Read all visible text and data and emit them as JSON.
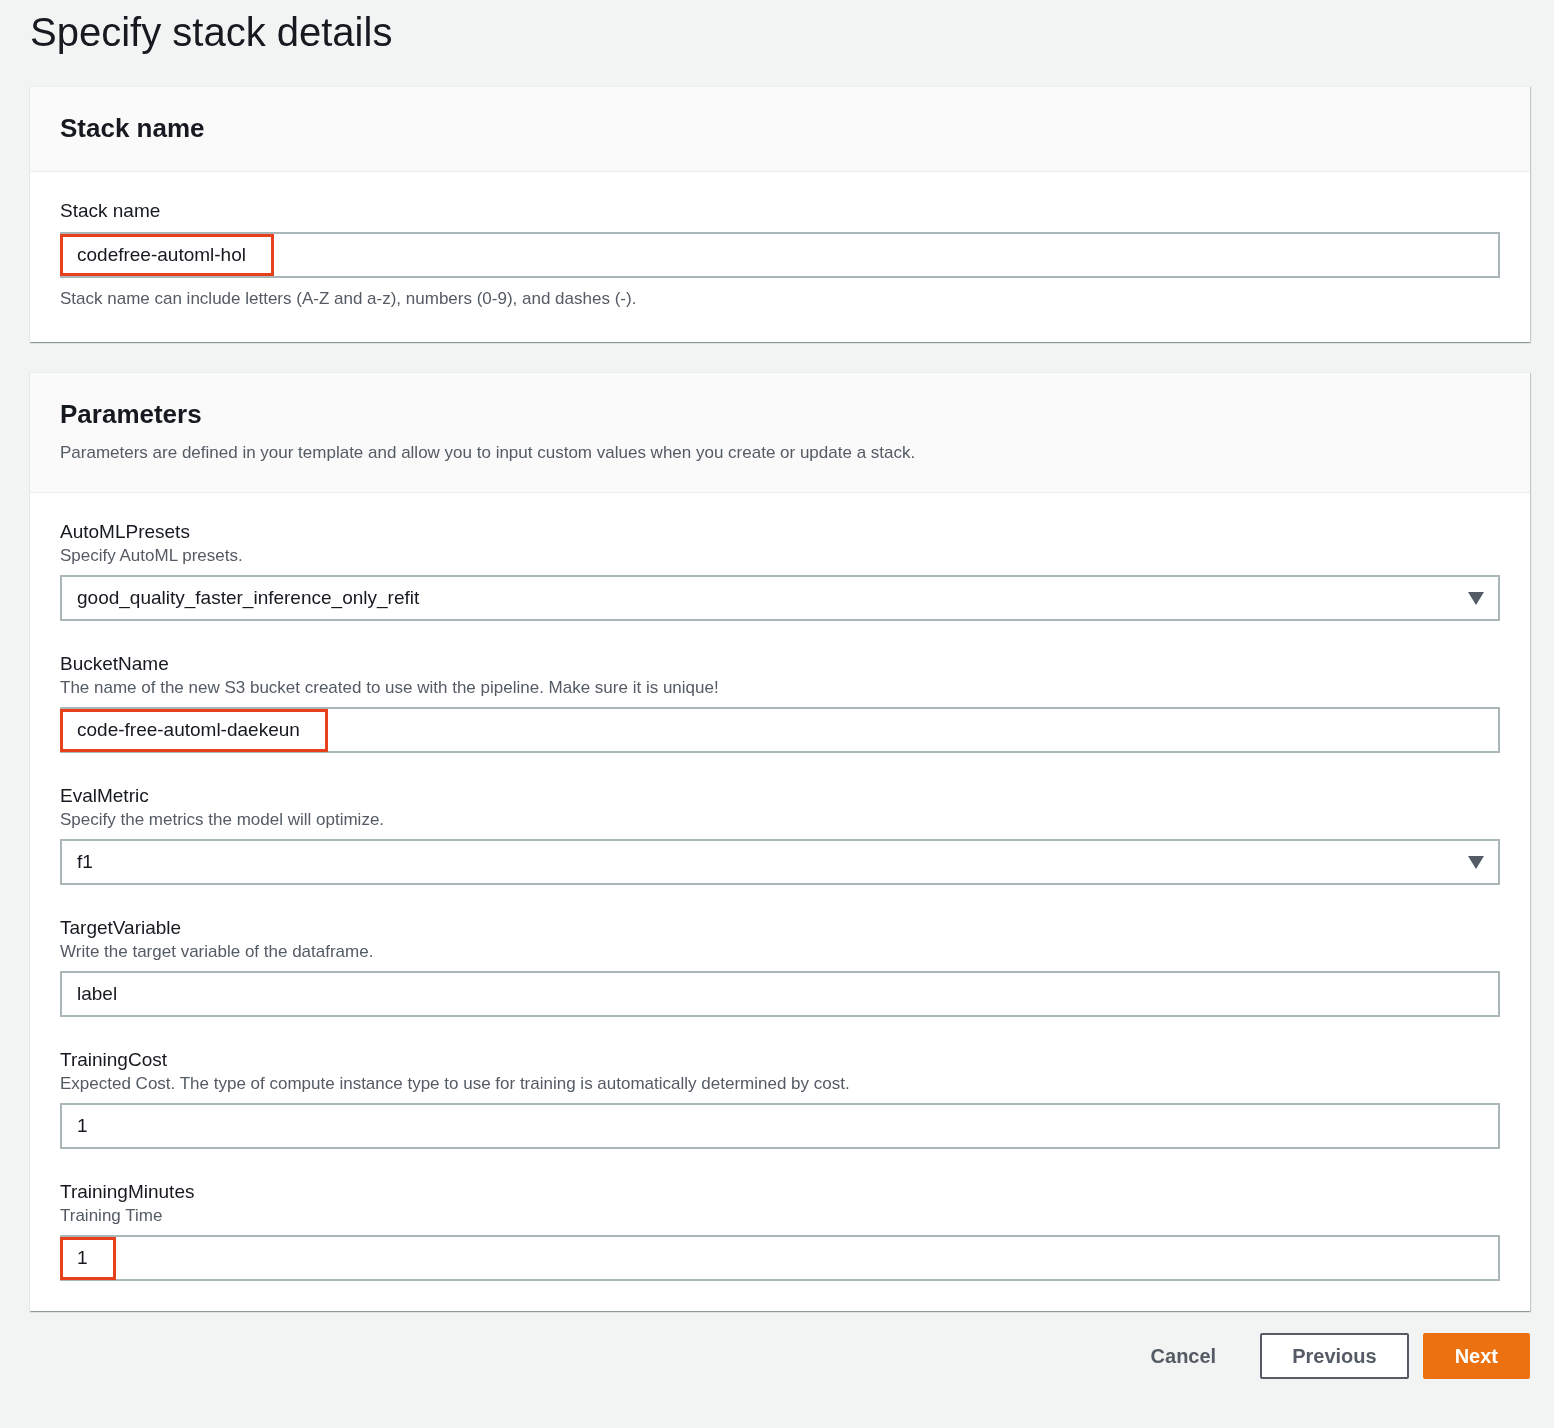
{
  "page_title": "Specify stack details",
  "sections": [
    {
      "title": "Stack name",
      "fields": [
        {
          "kind": "text",
          "label": "Stack name",
          "value": "codefree-automl-hol",
          "highlighted": true,
          "hint": "Stack name can include letters (A-Z and a-z), numbers (0-9), and dashes (-)."
        }
      ]
    },
    {
      "title": "Parameters",
      "description": "Parameters are defined in your template and allow you to input custom values when you create or update a stack.",
      "fields": [
        {
          "kind": "select",
          "label": "AutoMLPresets",
          "description": "Specify AutoML presets.",
          "value": "good_quality_faster_inference_only_refit",
          "highlighted": false
        },
        {
          "kind": "text",
          "label": "BucketName",
          "description": "The name of the new S3 bucket created to use with the pipeline. Make sure it is unique!",
          "value": "code-free-automl-daekeun",
          "highlighted": true
        },
        {
          "kind": "select",
          "label": "EvalMetric",
          "description": "Specify the metrics the model will optimize.",
          "value": "f1",
          "highlighted": false
        },
        {
          "kind": "text",
          "label": "TargetVariable",
          "description": "Write the target variable of the dataframe.",
          "value": "label",
          "highlighted": false
        },
        {
          "kind": "text",
          "label": "TrainingCost",
          "description": "Expected Cost. The type of compute instance type to use for training is automatically determined by cost.",
          "value": "1",
          "highlighted": false
        },
        {
          "kind": "text",
          "label": "TrainingMinutes",
          "description": "Training Time",
          "value": "1",
          "highlighted": true
        }
      ]
    }
  ],
  "buttons": [
    {
      "kind": "link",
      "label": "Cancel"
    },
    {
      "kind": "normal",
      "label": "Previous"
    },
    {
      "kind": "primary",
      "label": "Next"
    }
  ]
}
